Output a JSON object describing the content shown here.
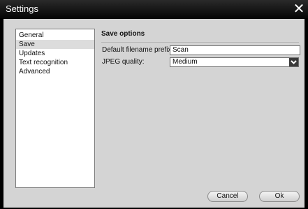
{
  "window": {
    "title": "Settings",
    "close_glyph": "✕"
  },
  "sidebar": {
    "items": [
      {
        "label": "General",
        "selected": false
      },
      {
        "label": "Save",
        "selected": true
      },
      {
        "label": "Updates",
        "selected": false
      },
      {
        "label": "Text recognition",
        "selected": false
      },
      {
        "label": "Advanced",
        "selected": false
      }
    ]
  },
  "save_options": {
    "title": "Save options",
    "filename_prefix": {
      "label": "Default filename prefix:",
      "value": "Scan"
    },
    "jpeg_quality": {
      "label": "JPEG quality:",
      "value": "Medium"
    }
  },
  "buttons": {
    "cancel": "Cancel",
    "ok": "Ok"
  }
}
